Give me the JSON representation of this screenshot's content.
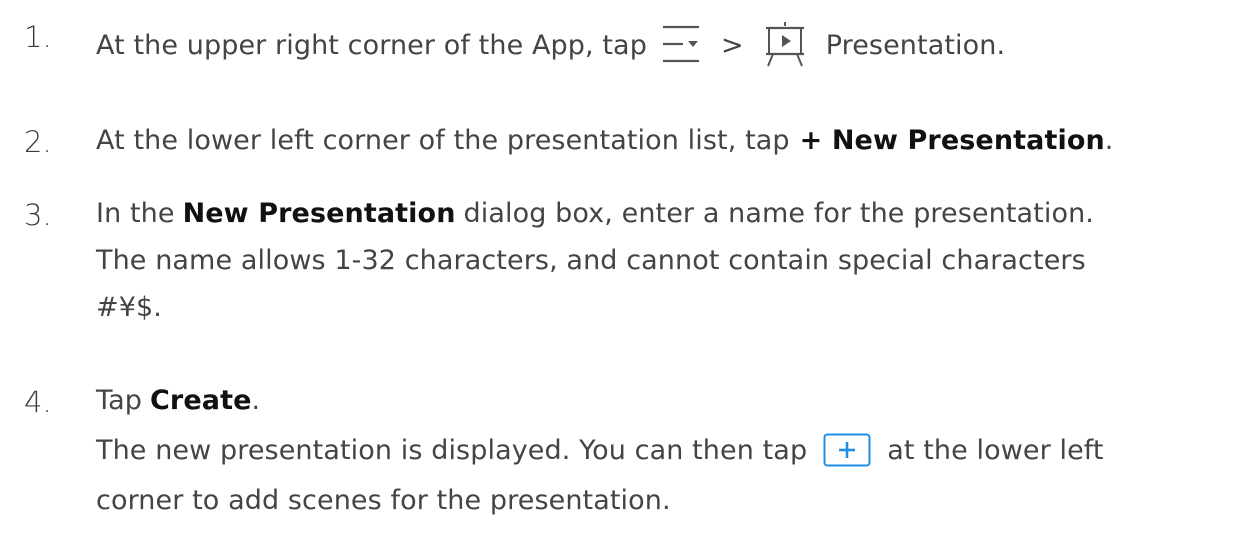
{
  "steps": [
    {
      "number": "1.",
      "t1": "At the upper right corner of the App, tap",
      "sep": ">",
      "t2": "Presentation."
    },
    {
      "number": "2.",
      "t1": "At the lower left corner of the presentation list, tap",
      "bold": "+ New Presentation",
      "t2": "."
    },
    {
      "number": "3.",
      "t1": "In the",
      "bold": "New Presentation",
      "t2": "dialog box, enter a name for the presentation.",
      "line2": "The name allows 1-32 characters, and cannot contain special characters",
      "line3": "#¥$."
    },
    {
      "number": "4.",
      "t1": "Tap",
      "bold": "Create",
      "t2": ".",
      "line2a": "The new presentation is displayed. You can then tap",
      "line2b": "at the lower left",
      "line3": "corner to add scenes for the presentation."
    }
  ],
  "icons": {
    "menu": "menu-dropdown-icon",
    "presentation": "presentation-screen-icon",
    "add": "add-scene-icon"
  },
  "colors": {
    "text": "#444444",
    "bold_text": "#111111",
    "icon_gray": "#555555",
    "add_icon_blue": "#1f8fe5"
  }
}
